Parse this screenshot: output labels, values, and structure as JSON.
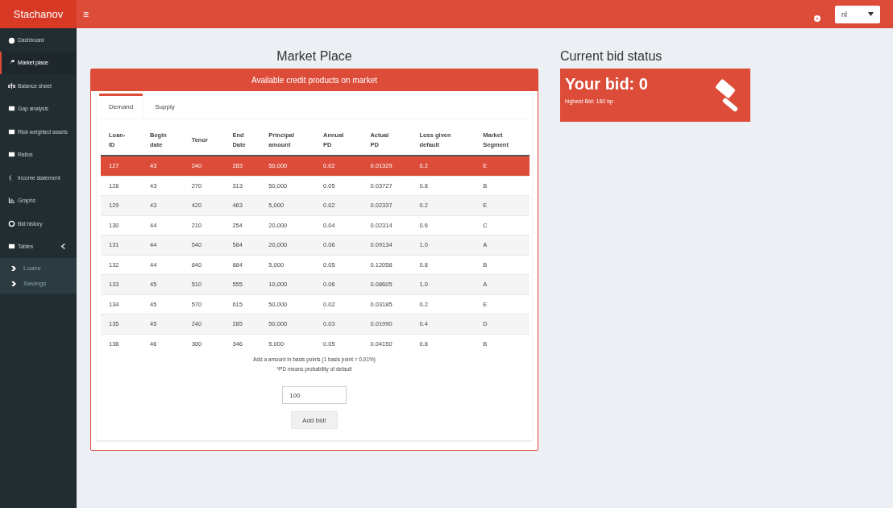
{
  "header": {
    "logo": "Stachanov",
    "menu_toggle": "≡",
    "language": "nl"
  },
  "sidebar": {
    "items": [
      {
        "label": "Dashboard",
        "selected": false
      },
      {
        "label": "Market place",
        "selected": true
      },
      {
        "label": "Balance sheet",
        "selected": false
      },
      {
        "label": "Gap analysis",
        "selected": false
      },
      {
        "label": "Risk weighted assets",
        "selected": false
      },
      {
        "label": "Ratios",
        "selected": false
      },
      {
        "label": "Income statement",
        "selected": false
      },
      {
        "label": "Graphs",
        "selected": false
      },
      {
        "label": "Bid history",
        "selected": false
      },
      {
        "label": "Tables",
        "selected": false,
        "expanded": true,
        "children": [
          {
            "label": "Loans",
            "selected": false
          },
          {
            "label": "Savings",
            "selected": false
          }
        ]
      }
    ]
  },
  "market": {
    "title": "Market Place",
    "box_title": "Available credit products on market",
    "tabs": [
      {
        "label": "Demand",
        "selected": true
      },
      {
        "label": "Supply",
        "selected": false
      }
    ],
    "table": {
      "columns": [
        "Loan-\nID",
        "Begin\ndate",
        "Tenor",
        "End\nDate",
        "Principal\namount",
        "Annual\nPD",
        "Actual\nPD",
        "Loss given\ndefault",
        "Market\nSegment"
      ],
      "rows": [
        {
          "selected": true,
          "cells": [
            "127",
            "43",
            "240",
            "283",
            "50,000",
            "0.02",
            "0.01329",
            "0.2",
            "E"
          ]
        },
        {
          "selected": false,
          "cells": [
            "128",
            "43",
            "270",
            "313",
            "50,000",
            "0.05",
            "0.03727",
            "0.8",
            "B"
          ]
        },
        {
          "selected": false,
          "cells": [
            "129",
            "43",
            "420",
            "463",
            "5,000",
            "0.02",
            "0.02337",
            "0.2",
            "E"
          ]
        },
        {
          "selected": false,
          "cells": [
            "130",
            "44",
            "210",
            "254",
            "20,000",
            "0.04",
            "0.02314",
            "0.6",
            "C"
          ]
        },
        {
          "selected": false,
          "cells": [
            "131",
            "44",
            "540",
            "584",
            "20,000",
            "0.06",
            "0.09134",
            "1.0",
            "A"
          ]
        },
        {
          "selected": false,
          "cells": [
            "132",
            "44",
            "840",
            "884",
            "5,000",
            "0.05",
            "0.12058",
            "0.8",
            "B"
          ]
        },
        {
          "selected": false,
          "cells": [
            "133",
            "45",
            "510",
            "555",
            "10,000",
            "0.06",
            "0.08605",
            "1.0",
            "A"
          ]
        },
        {
          "selected": false,
          "cells": [
            "134",
            "45",
            "570",
            "615",
            "50,000",
            "0.02",
            "0.03185",
            "0.2",
            "E"
          ]
        },
        {
          "selected": false,
          "cells": [
            "135",
            "45",
            "240",
            "285",
            "50,000",
            "0.03",
            "0.01990",
            "0.4",
            "D"
          ]
        },
        {
          "selected": false,
          "cells": [
            "136",
            "46",
            "300",
            "346",
            "5,000",
            "0.05",
            "0.04150",
            "0.8",
            "B"
          ]
        }
      ]
    },
    "notes": [
      "Add a amount in basis points (1 basis point = 0,01%)",
      "*PD means probability of default"
    ],
    "bid_input": "100",
    "button": "Add bid!"
  },
  "bid_status": {
    "title": "Current bid status",
    "value": "Your bid: 0",
    "highest": "highest Bid: 160 bp"
  }
}
